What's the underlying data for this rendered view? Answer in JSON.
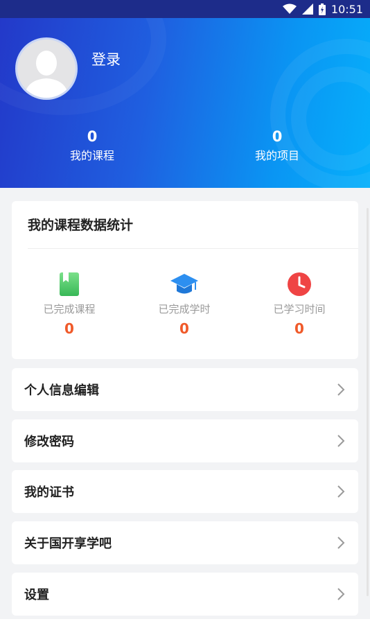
{
  "status_bar": {
    "time": "10:51"
  },
  "profile": {
    "login_label": "登录",
    "stats": [
      {
        "value": "0",
        "label": "我的课程"
      },
      {
        "value": "0",
        "label": "我的项目"
      }
    ]
  },
  "course_stats": {
    "title": "我的课程数据统计",
    "metrics": [
      {
        "label": "已完成课程",
        "value": "0",
        "icon": "book-icon",
        "color": "#5ccf6e"
      },
      {
        "label": "已完成学时",
        "value": "0",
        "icon": "graduation-cap-icon",
        "color": "#2d8ff0"
      },
      {
        "label": "已学习时间",
        "value": "0",
        "icon": "clock-icon",
        "color": "#ef4444"
      }
    ]
  },
  "menu": [
    {
      "label": "个人信息编辑"
    },
    {
      "label": "修改密码"
    },
    {
      "label": "我的证书"
    },
    {
      "label": "关于国开享学吧"
    },
    {
      "label": "设置"
    }
  ],
  "colors": {
    "accent_value": "#f05a2a",
    "header_start": "#2339c9",
    "header_end": "#06b0fb"
  }
}
